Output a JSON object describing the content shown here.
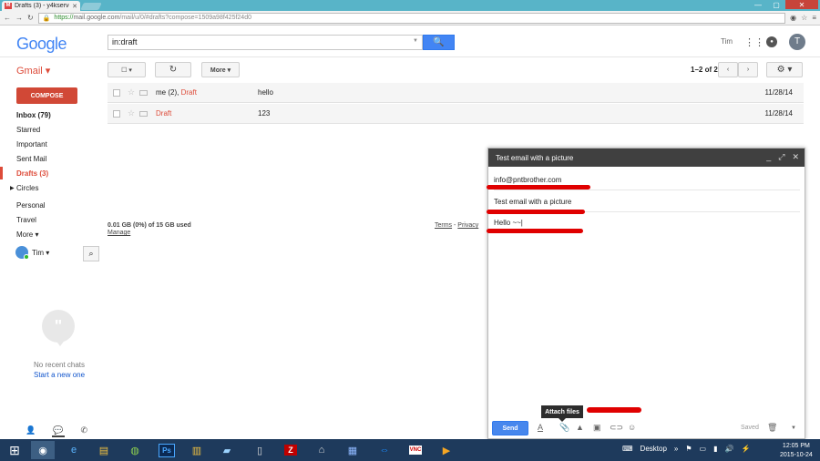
{
  "browser": {
    "tab_title": "Drafts (3) - y4kserve",
    "tab_icon": "M",
    "url_scheme": "https://",
    "url_host": "mail.google.com",
    "url_path": "/mail/u/0/#drafts?compose=1509a98f425f24d0",
    "window_controls": {
      "minimize": "—",
      "maximize": "▢",
      "close": "✕"
    }
  },
  "header": {
    "logo": "Google",
    "search_value": "in:draft",
    "user_name": "Tim",
    "avatar_letter": "T"
  },
  "toolbar": {
    "app_label": "Gmail ▾",
    "select_label": "☐ ▾",
    "refresh_label": "↻",
    "more_label": "More ▾",
    "page_count": "1–2 of 2",
    "prev": "‹",
    "next": "›",
    "settings_label": "⚙ ▾"
  },
  "sidebar": {
    "compose_label": "COMPOSE",
    "items": [
      "Inbox (79)",
      "Starred",
      "Important",
      "Sent Mail",
      "Drafts (3)",
      "Circles",
      "Personal",
      "Travel",
      "More ▾"
    ],
    "hangouts_user": "Tim ▾",
    "no_chats": "No recent chats",
    "start_chat": "Start a new one"
  },
  "messages": [
    {
      "from_plain": "me (2),",
      "from_draft": "Draft",
      "subject": "hello",
      "date": "11/28/14"
    },
    {
      "from_plain": "",
      "from_draft": "Draft",
      "subject": "123",
      "date": "11/28/14"
    }
  ],
  "footer": {
    "storage": "0.01 GB (0%) of 15 GB used",
    "manage": "Manage",
    "terms": "Terms",
    "separator": " - ",
    "privacy": "Privacy"
  },
  "compose_window": {
    "title": "Test email with a picture",
    "to": "info@pntbrother.com",
    "subject": "Test email with a picture",
    "body": "Hello ~~|",
    "send_label": "Send",
    "tooltip": "Attach files",
    "saved_label": "Saved"
  },
  "taskbar": {
    "desktop_label": "Desktop",
    "time": "12:05 PM",
    "date": "2015-10-24"
  },
  "colors": {
    "gmail_red": "#dd4b39",
    "search_blue": "#4285f4",
    "compose_header": "#404040",
    "taskbar": "#1e3a5c",
    "annotation_red": "#e00000"
  }
}
